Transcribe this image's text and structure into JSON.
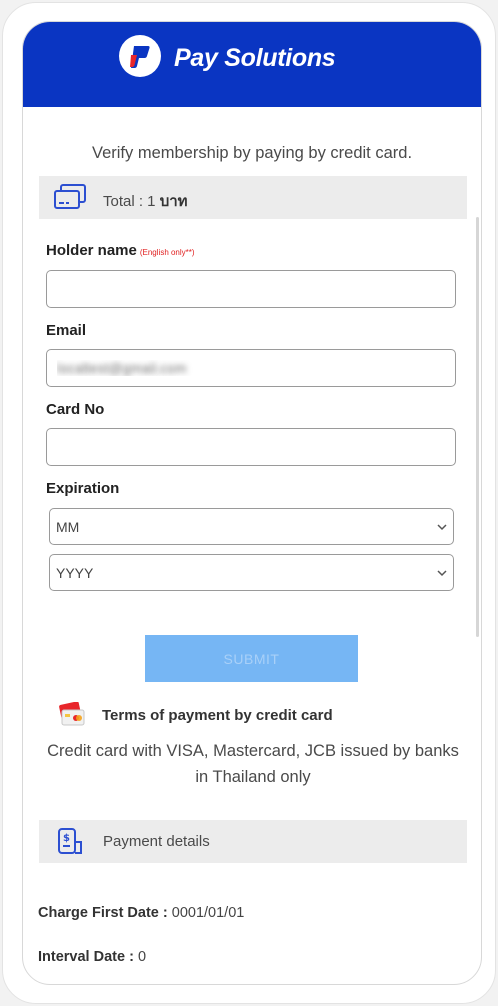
{
  "header": {
    "brand": "Pay Solutions"
  },
  "intro": "Verify membership by paying by credit card.",
  "total": {
    "label": "Total : 1",
    "currency": "บาท"
  },
  "form": {
    "holder_label": "Holder name",
    "holder_note": "(English only**)",
    "holder_value": "",
    "email_label": "Email",
    "email_value": "localtest@gmail.com",
    "card_label": "Card No",
    "card_value": "",
    "expiration_label": "Expiration",
    "month_value": "MM",
    "year_value": "YYYY",
    "submit_label": "SUBMIT"
  },
  "terms": {
    "title": "Terms of payment by credit card",
    "body": "Credit card with VISA, Mastercard, JCB issued by banks in Thailand only"
  },
  "payment_details": {
    "title": "Payment details",
    "charge_label": "Charge First Date :",
    "charge_value": "0001/01/01",
    "interval_label": "Interval Date :",
    "interval_value": "0"
  },
  "colors": {
    "brand_blue": "#0a35c2",
    "submit_disabled": "#76b6f4",
    "note_red": "#e02020"
  }
}
